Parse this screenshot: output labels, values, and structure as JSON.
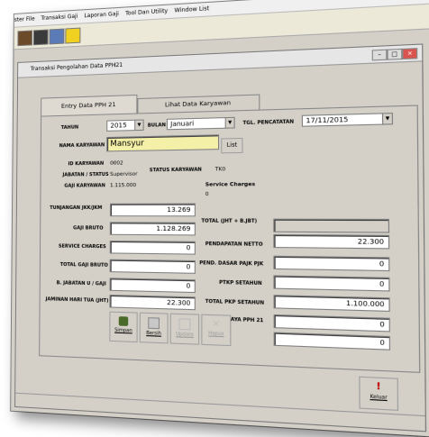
{
  "menubar": {
    "items": [
      "ster File",
      "Transaksi Gaji",
      "Laporan Gaji",
      "Tool Dan Utility",
      "Window List"
    ]
  },
  "toolbar": {
    "icons": [
      "door-icon",
      "people-icon",
      "document-icon",
      "mail-icon"
    ]
  },
  "window": {
    "title": "Transaksi Pengolahan Data PPH21"
  },
  "tabs": {
    "entry": "Entry Data PPH 21",
    "lihat": "Lihat Data Karyawan"
  },
  "form": {
    "tahun_label": "TAHUN",
    "tahun_value": "2015",
    "bulan_label": "BULAN",
    "bulan_value": "Januari",
    "tgl_label": "TGL. PENCATATAN",
    "tgl_value": "17/11/2015",
    "nama_label": "NAMA KARYAWAN",
    "nama_value": "Mansyur",
    "list_label": "List",
    "id_label": "ID KARYAWAN",
    "id_value": "0002",
    "status_label": "STATUS KARYAWAN",
    "status_value": "TK0",
    "jabatan_label": "JABATAN / STATUS",
    "jabatan_value": "Supervisor",
    "gaji_label": "GAJI KARYAWAN",
    "gaji_value": "1.115.000",
    "service_label": "Service Charges",
    "service_value": "0",
    "tunjangan_label": "TUNJANGAN JKK/JKM",
    "tunjangan_value": "13.269",
    "gaji_bruto_label": "GAJI BRUTO",
    "gaji_bruto_value": "1.128.269",
    "service2_label": "SERVICE CHARGES",
    "service2_value": "0",
    "total_gaji_label": "TOTAL GAJI BRUTO",
    "total_gaji_value": "0",
    "b_jabatan_label": "B. JABATAN U / GAJI",
    "b_jabatan_value": "0",
    "jht_label": "JAMINAN HARI TUA (JHT)",
    "jht_value": "22.300",
    "total_jht_label": "TOTAL (JHT + B.JBT)",
    "total_jht_value": "22.300",
    "pendapatan_label": "PENDAPATAN NETTO",
    "pendapatan_value": "0",
    "pend_dasar_label": "PEND. DASAR PAJK PJK",
    "pend_dasar_value": "0",
    "ptkp_label": "PTKP SETAHUN",
    "ptkp_value": "1.100.000",
    "total_pkp_label": "TOTAL PKP SETAHUN",
    "total_pkp_value": "0",
    "biaya_label": "BIAYA PPH 21",
    "biaya_value": "0"
  },
  "actions": {
    "simpan": "Simpan",
    "bersih": "Bersih",
    "update": "Update",
    "hapus": "Hapus",
    "keluar": "Keluar"
  },
  "statusbar": {
    "text": ""
  }
}
